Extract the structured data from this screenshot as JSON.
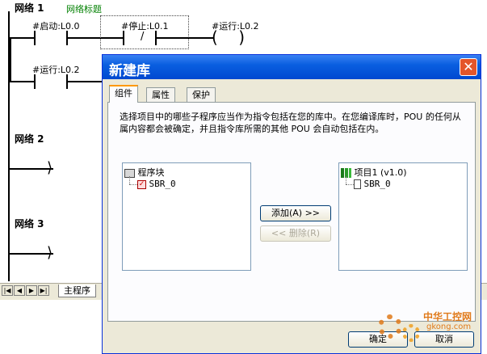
{
  "editor": {
    "network1": {
      "title": "网络 1",
      "comment": "网络标题"
    },
    "network2": {
      "title": "网络 2"
    },
    "network3": {
      "title": "网络 3"
    },
    "contacts": {
      "start": "#启动:L0.0",
      "stop": "#停止:L0.1",
      "stop_symbol": "/",
      "coil": "#运行:L0.2",
      "hold": "#运行:L0.2"
    }
  },
  "tabbar": {
    "main_tab": "主程序"
  },
  "dialog": {
    "title": "新建库",
    "close_label": "✕",
    "tabs": [
      "组件",
      "属性",
      "保护"
    ],
    "description": "选择项目中的哪些子程序应当作为指令包括在您的库中。在您编译库时，POU 的任何从属内容都会被确定，并且指令库所需的其他 POU 会自动包括在内。",
    "left_tree": {
      "root": "程序块",
      "child": "SBR_0"
    },
    "right_tree": {
      "root": "项目1 (v1.0)",
      "child": "SBR_0"
    },
    "add_button": "添加(A) >>",
    "remove_button": "<< 删除(R)",
    "ok_button": "确定",
    "cancel_button": "取消"
  },
  "watermark": {
    "text1": "中华工控网",
    "text2": "gkong.com"
  },
  "colors": {
    "titlebar": "#0a5fe0",
    "network_comment": "#008000",
    "watermark": "#e07a1a"
  }
}
